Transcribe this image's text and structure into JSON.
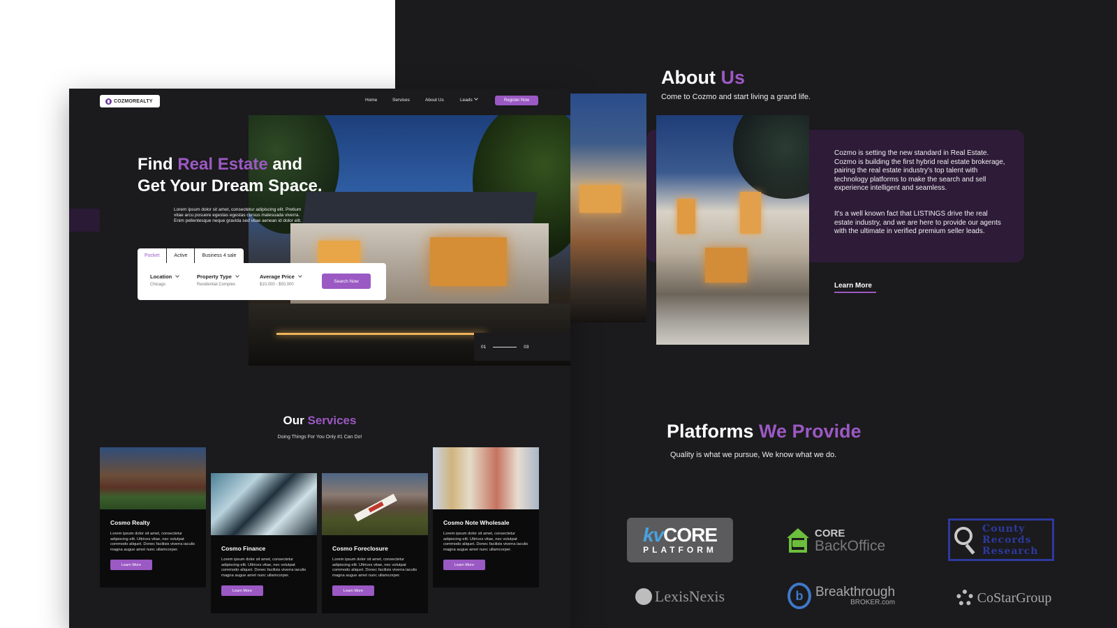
{
  "home": {
    "logo_text": "COZMOREALTY",
    "nav": [
      "Home",
      "Services",
      "About Us",
      "Leads"
    ],
    "register_label": "Register Now",
    "hero": {
      "title_a": "Find ",
      "title_highlight": "Real Estate",
      "title_b": " and",
      "title_line2": "Get Your Dream Space.",
      "description": "Lorem ipsum dolor sit amet, consectetur adipiscing elit. Pretium vitae arcu posuere egestas egestas cursus malesuada viverra. Enim pellentesque neque gravida sed vitae aenean id dolor elit.",
      "slide_current": "01",
      "slide_total": "03"
    },
    "search": {
      "tabs": [
        "Pocket",
        "Active",
        "Business 4 sale"
      ],
      "active_tab": "Pocket",
      "fields": [
        {
          "label": "Location",
          "value": "Chicago"
        },
        {
          "label": "Property Type",
          "value": "Residential Complex"
        },
        {
          "label": "Average Price",
          "value": "$10,000 - $50,000"
        }
      ],
      "button": "Search Now"
    },
    "services": {
      "title_a": "Our ",
      "title_highlight": "Services",
      "subtitle": "Doing Things For You Only #1 Can Do!",
      "cards": [
        {
          "title": "Cosmo Realty",
          "text": "Lorem ipsum dolor sit amet, consectetur adipiscing elit. Ultrices vitae, nec volutpat commodo aliquet. Donec facilisis viverra iaculis magna augue amet nunc ullamcorper.",
          "button": "Learn More"
        },
        {
          "title": "Cosmo Finance",
          "text": "Lorem ipsum dolor sit amet, consectetur adipiscing elit. Ultrices vitae, nec volutpat commodo aliquet. Donec facilisis viverra iaculis magna augue amet nunc ullamcorper.",
          "button": "Learn More"
        },
        {
          "title": "Cosmo Foreclosure",
          "text": "Lorem ipsum dolor sit amet, consectetur adipiscing elit. Ultrices vitae, nec volutpat commodo aliquet. Donec facilisis viverra iaculis magna augue amet nunc ullamcorper.",
          "button": "Learn More"
        },
        {
          "title": "Cosmo Note Wholesale",
          "text": "Lorem ipsum dolor sit amet, consectetur adipiscing elit. Ultrices vitae, nec volutpat commodo aliquet. Donec facilisis viverra iaculis magna augue amet nunc ullamcorper.",
          "button": "Learn More"
        }
      ]
    }
  },
  "about": {
    "title_a": "About ",
    "title_highlight": "Us",
    "subtitle": "Come to Cozmo and start living a grand life.",
    "paragraph1": "Cozmo is setting the new standard in Real Estate. Cozmo is building the first hybrid real estate brokerage, pairing the real estate industry's top talent with technology platforms to make the search and sell experience intelligent and seamless.",
    "paragraph2": "It's a well known fact that LISTINGS drive the real estate industry, and we are here to provide our agents with the ultimate in verified premium seller leads.",
    "learn_more": "Learn More"
  },
  "platforms": {
    "title_a": "Platforms ",
    "title_highlight": "We Provide",
    "subtitle": "Quality is what we pursue, We know what we do.",
    "logos": {
      "kvcore_top_k": "kv",
      "kvcore_top": "CORE",
      "kvcore_bottom": "PLATFORM",
      "core_top": "CORE",
      "core_bottom": "BackOffice",
      "county_1": "County",
      "county_2": "Records",
      "county_3": "Research",
      "lexis": "LexisNexis",
      "bt_mark": "b",
      "bt_top": "Breakthrough",
      "bt_bottom": "BROKER.com",
      "costar": "CoStarGroup"
    }
  },
  "colors": {
    "accent": "#9b59c4",
    "background": "#1b1a1c",
    "about_panel": "#2d1b38"
  }
}
